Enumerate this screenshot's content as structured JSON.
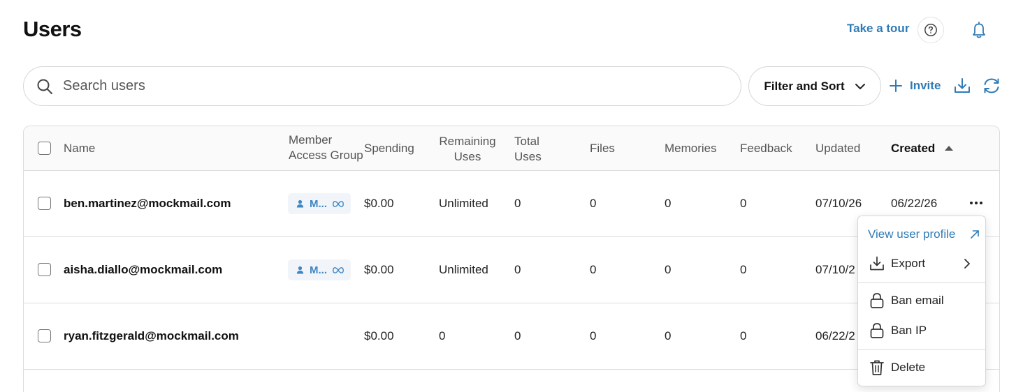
{
  "header": {
    "title": "Users",
    "tour_label": "Take a tour"
  },
  "toolbar": {
    "search_placeholder": "Search users",
    "filter_label": "Filter and Sort",
    "invite_label": "Invite"
  },
  "table": {
    "columns": {
      "name": "Name",
      "member_access_group_line1": "Member",
      "member_access_group_line2": "Access Group",
      "spending": "Spending",
      "remaining_uses_line1": "Remaining",
      "remaining_uses_line2": "Uses",
      "total_uses_line1": "Total",
      "total_uses_line2": "Uses",
      "files": "Files",
      "memories": "Memories",
      "feedback": "Feedback",
      "updated": "Updated",
      "created": "Created"
    },
    "sort": {
      "column": "Created",
      "direction": "ascending"
    },
    "rows": [
      {
        "email": "ben.martinez@mockmail.com",
        "group": "M...",
        "spending": "$0.00",
        "remaining_uses": "Unlimited",
        "total_uses": "0",
        "files": "0",
        "memories": "0",
        "feedback": "0",
        "updated": "07/10/26",
        "created": "06/22/26"
      },
      {
        "email": "aisha.diallo@mockmail.com",
        "group": "M...",
        "spending": "$0.00",
        "remaining_uses": "Unlimited",
        "total_uses": "0",
        "files": "0",
        "memories": "0",
        "feedback": "0",
        "updated": "07/10/2"
      },
      {
        "email": "ryan.fitzgerald@mockmail.com",
        "spending": "$0.00",
        "remaining_uses": "0",
        "total_uses": "0",
        "files": "0",
        "memories": "0",
        "feedback": "0",
        "updated": "06/22/2"
      }
    ]
  },
  "row_menu": {
    "view_profile": "View user profile",
    "export": "Export",
    "ban_email": "Ban email",
    "ban_ip": "Ban IP",
    "delete": "Delete"
  },
  "colors": {
    "accent": "#2f7bb6",
    "border": "#dcdcdc",
    "header_bg": "#fafafa"
  },
  "icons": [
    "search-icon",
    "chevron-down-icon",
    "plus-icon",
    "download-icon",
    "refresh-icon",
    "help-icon",
    "bell-icon",
    "person-icon",
    "infinity-icon",
    "more-icon",
    "external-link-icon",
    "chevron-right-icon",
    "lock-icon",
    "trash-icon"
  ]
}
